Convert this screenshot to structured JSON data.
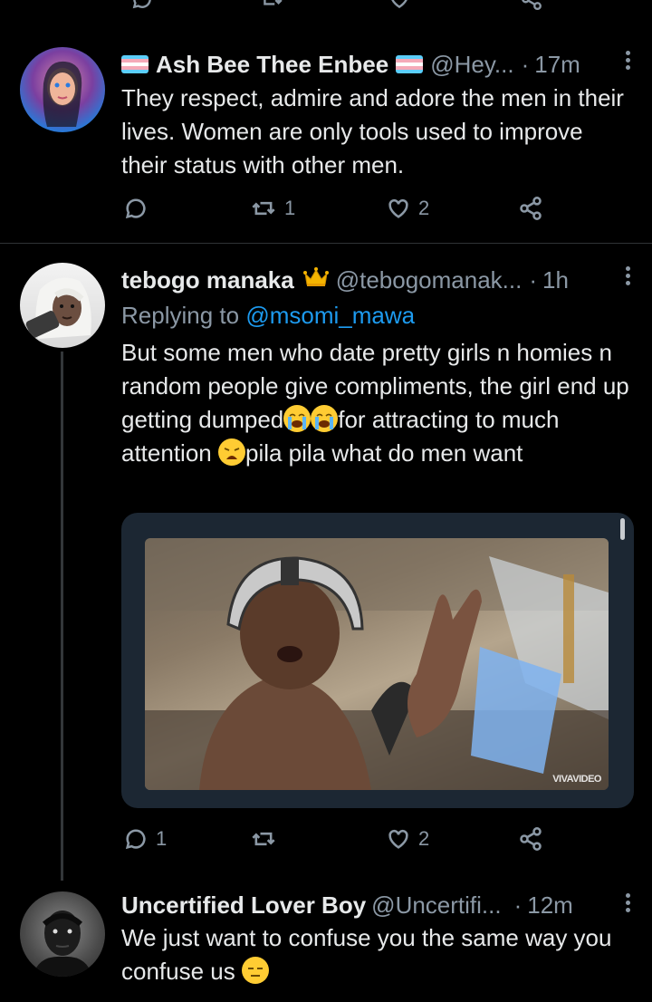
{
  "tweets": [
    {
      "display_name": "Ash Bee Thee Enbee",
      "handle": "@Hey...",
      "time": "17m",
      "text": "They respect, admire and adore the men in their lives. Women are only tools used to improve their status with other men.",
      "reply_count": "",
      "retweet_count": "1",
      "like_count": "2"
    },
    {
      "display_name": "tebogo manaka",
      "handle": "@tebogomanak...",
      "time": "1h",
      "replying_prefix": "Replying to",
      "replying_to": "@msomi_mawa",
      "text_part1": "But some men who date pretty girls n homies n random people give compliments, the girl end up  getting dumped",
      "text_part2": "for attracting to much attention",
      "text_part3": "pila pila what do men want",
      "media_watermark": "VIVAVIDEO",
      "reply_count": "1",
      "retweet_count": "",
      "like_count": "2"
    },
    {
      "display_name": "Uncertified Lover Boy",
      "handle": "@Uncertifi...",
      "time": "12m",
      "text": "We just want to confuse you the same way you confuse us"
    }
  ],
  "separator": "·",
  "icons": {
    "reply": "reply-icon",
    "retweet": "retweet-icon",
    "like": "heart-icon",
    "share": "share-icon",
    "more": "more-icon",
    "trans_flag_colors": [
      "#5bcefa",
      "#f5a9b8",
      "#ffffff",
      "#f5a9b8",
      "#5bcefa"
    ]
  },
  "colors": {
    "background": "#000000",
    "text": "#e7e9ea",
    "secondary": "#8b98a5",
    "link": "#1d9bf0"
  }
}
